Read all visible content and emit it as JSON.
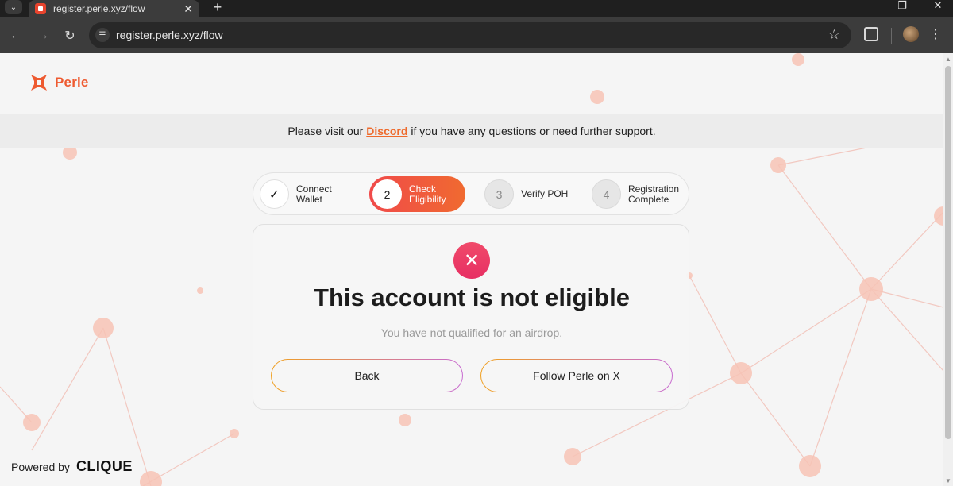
{
  "browser": {
    "tab_title": "register.perle.xyz/flow",
    "url": "register.perle.xyz/flow",
    "tab_close": "✕",
    "new_tab": "+",
    "tab_menu": "⌄"
  },
  "brand": {
    "name": "Perle",
    "color": "#ee5a30"
  },
  "notice": {
    "prefix": "Please visit our",
    "link": "Discord",
    "suffix": "if you have any questions or need further support."
  },
  "steps": [
    {
      "number": "✓",
      "label_1": "Connect",
      "label_2": "Wallet",
      "state": "done"
    },
    {
      "number": "2",
      "label_1": "Check",
      "label_2": "Eligibility",
      "state": "active"
    },
    {
      "number": "3",
      "label_1": "Verify POH",
      "label_2": "",
      "state": "pending"
    },
    {
      "number": "4",
      "label_1": "Registration",
      "label_2": "Complete",
      "state": "pending"
    }
  ],
  "result": {
    "icon": "x-icon",
    "title": "This account is not eligible",
    "subtitle": "You have not qualified for an airdrop.",
    "back_label": "Back",
    "follow_label": "Follow Perle on X"
  },
  "footer": {
    "powered_by": "Powered by",
    "partner": "CLIQUE"
  }
}
